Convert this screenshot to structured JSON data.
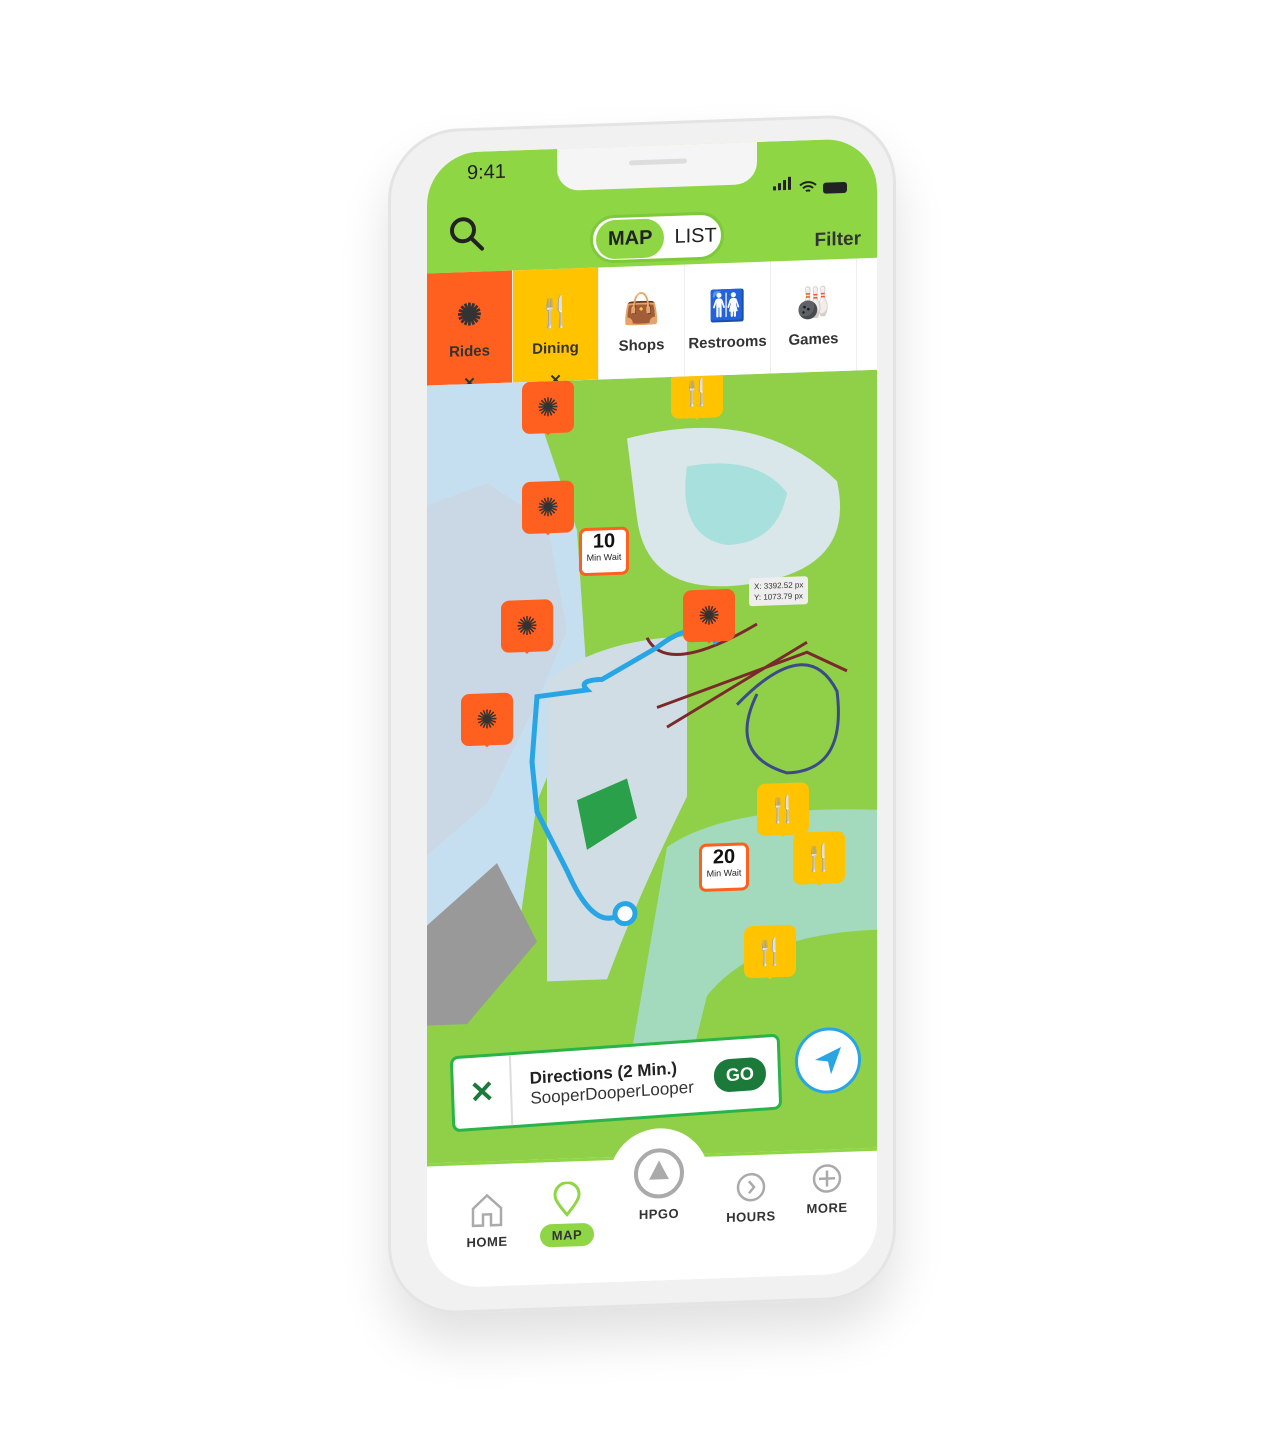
{
  "status_bar": {
    "time": "9:41"
  },
  "header": {
    "view_toggle": {
      "active": "MAP",
      "inactive": "LIST"
    },
    "filter_label": "Filter",
    "search_icon": "search-icon"
  },
  "categories": [
    {
      "label": "Rides",
      "icon": "ferris-wheel-icon",
      "selected": true,
      "color": "#ff5f1f"
    },
    {
      "label": "Dining",
      "icon": "fork-spoon-icon",
      "selected": true,
      "color": "#ffc300"
    },
    {
      "label": "Shops",
      "icon": "shopping-bag-icon",
      "selected": false
    },
    {
      "label": "Restrooms",
      "icon": "restroom-icon",
      "selected": false
    },
    {
      "label": "Games",
      "icon": "games-icon",
      "selected": false
    }
  ],
  "map": {
    "wait_badges": [
      {
        "value": "10",
        "unit": "Min Wait"
      },
      {
        "value": "20",
        "unit": "Min Wait"
      }
    ],
    "coords": {
      "x": "X: 3392.52 px",
      "y": "Y: 1073.79 px"
    }
  },
  "directions": {
    "title": "Directions (2 Min.)",
    "destination": "SooperDooperLooper",
    "go_label": "GO"
  },
  "bottom_nav": [
    {
      "label": "HOME",
      "active": false
    },
    {
      "label": "MAP",
      "active": true
    },
    {
      "label": "HPGO",
      "active": false
    },
    {
      "label": "HOURS",
      "active": false
    },
    {
      "label": "MORE",
      "active": false
    }
  ],
  "colors": {
    "brand_green": "#8fd645",
    "rides": "#ff5f1f",
    "dining": "#ffc300",
    "route": "#27a5e4",
    "go": "#1b7a3a"
  }
}
